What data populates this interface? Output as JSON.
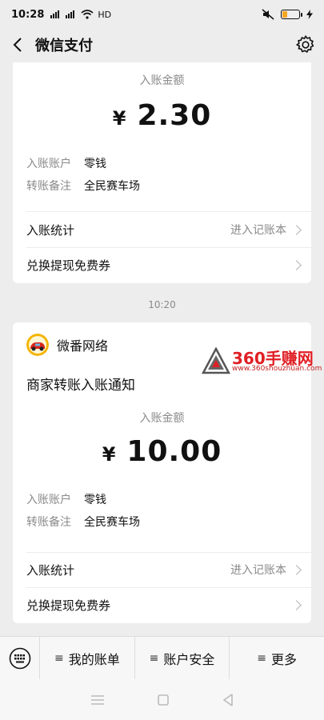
{
  "status": {
    "time": "10:28",
    "network": "HD",
    "signal1": "▮▮▮",
    "signal2": "▮▮▮",
    "battery_level": 0.3,
    "battery_color": "#f5a623"
  },
  "nav": {
    "title": "微信支付",
    "back_icon": "chevron-left-icon",
    "settings_icon": "gear-icon"
  },
  "card1": {
    "amount_label": "入账金额",
    "currency": "¥",
    "amount": "2.30",
    "account_key": "入账账户",
    "account_value": "零钱",
    "note_key": "转账备注",
    "note_value": "全民赛车场",
    "stats_label": "入账统计",
    "stats_hint": "进入记账本",
    "coupon_label": "兑换提现免费券"
  },
  "timestamp": "10:20",
  "card2": {
    "sender_name": "微番网络",
    "notice_title": "商家转账入账通知",
    "amount_label": "入账金额",
    "currency": "¥",
    "amount": "10.00",
    "account_key": "入账账户",
    "account_value": "零钱",
    "note_key": "转账备注",
    "note_value": "全民赛车场",
    "stats_label": "入账统计",
    "stats_hint": "进入记账本",
    "coupon_label": "兑换提现免费券"
  },
  "watermark": {
    "big": "360手赚网",
    "small": "www.360shouzhuan.com"
  },
  "bottom_menu": {
    "keyboard_icon": "keyboard-icon",
    "items": [
      {
        "label": "我的账单"
      },
      {
        "label": "账户安全"
      },
      {
        "label": "更多"
      }
    ]
  },
  "colors": {
    "background": "#ededed",
    "card": "#ffffff",
    "secondary_text": "#8a8a8a",
    "watermark_red": "#e01f24"
  }
}
